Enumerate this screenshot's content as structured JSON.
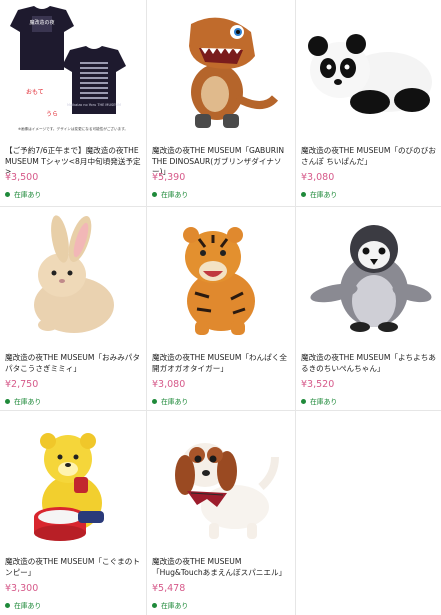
{
  "stock_label": "在庫あり",
  "tshirt": {
    "label_front": "おもて",
    "label_back": "うら",
    "print_front": "魔改造の夜",
    "print_brand": "Maikaizo no Yoru THE MUSEUM",
    "note": "※画像はイメージです。デザインは変更になる可能性がございます。"
  },
  "products": [
    {
      "title": "【ご予約7/6正午まで】魔改造の夜THE MUSEUM Tシャツ<8月中旬頃発送予定>",
      "price": "¥3,500"
    },
    {
      "title": "魔改造の夜THE MUSEUM「GABURIN THE DINOSAUR(ガブリンザダイナソー)」",
      "price": "¥5,390"
    },
    {
      "title": "魔改造の夜THE MUSEUM「のびのびおさんぽ ちいぱんだ」",
      "price": "¥3,080"
    },
    {
      "title": "魔改造の夜THE MUSEUM「おみみパタパタこうさぎミミィ」",
      "price": "¥2,750"
    },
    {
      "title": "魔改造の夜THE MUSEUM「わんぱく全開ガオガオタイガー」",
      "price": "¥3,080"
    },
    {
      "title": "魔改造の夜THE MUSEUM「よちよちあるきのちいぺんちゃん」",
      "price": "¥3,520"
    },
    {
      "title": "魔改造の夜THE MUSEUM「こぐまのトンピー」",
      "price": "¥3,300"
    },
    {
      "title": "魔改造の夜THE MUSEUM「Hug&Touchあまえんぼスパニエル」",
      "price": "¥5,478"
    }
  ]
}
